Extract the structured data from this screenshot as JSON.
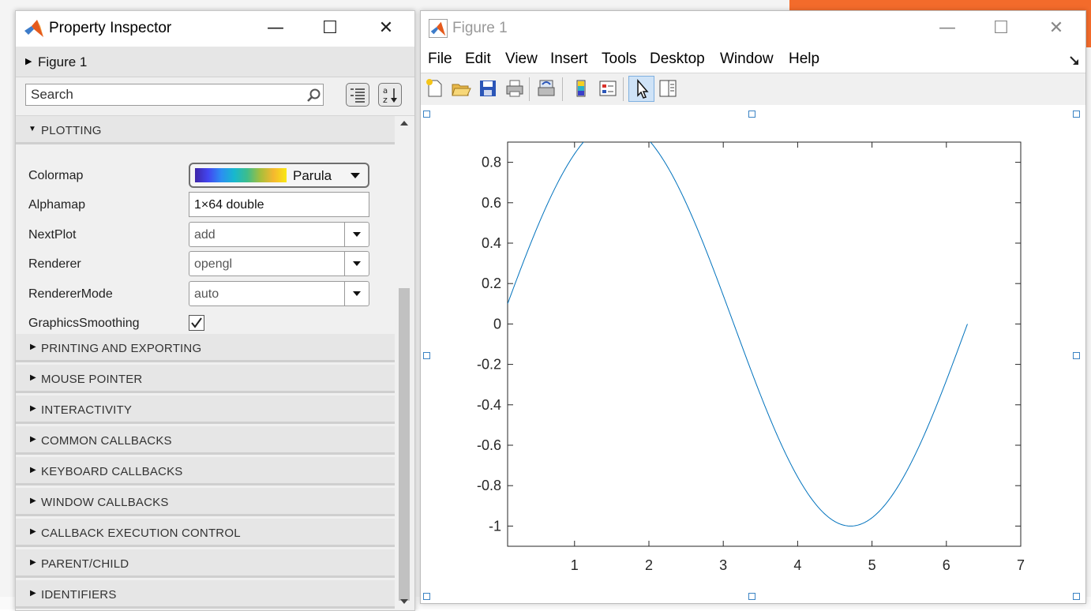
{
  "inspector": {
    "title": "Property Inspector",
    "object_label": "Figure 1",
    "search_placeholder": "Search",
    "plotting_section": "PLOTTING",
    "properties": {
      "colormap": {
        "label": "Colormap",
        "value": "Parula"
      },
      "alphamap": {
        "label": "Alphamap",
        "value": "1×64 double"
      },
      "nextplot": {
        "label": "NextPlot",
        "value": "add"
      },
      "renderer": {
        "label": "Renderer",
        "value": "opengl"
      },
      "renderermode": {
        "label": "RendererMode",
        "value": "auto"
      },
      "graphicssmoothing": {
        "label": "GraphicsSmoothing",
        "checked": true
      }
    },
    "sections": [
      "PRINTING AND EXPORTING",
      "MOUSE POINTER",
      "INTERACTIVITY",
      "COMMON CALLBACKS",
      "KEYBOARD CALLBACKS",
      "WINDOW CALLBACKS",
      "CALLBACK EXECUTION CONTROL",
      "PARENT/CHILD",
      "IDENTIFIERS"
    ]
  },
  "figure": {
    "title": "Figure 1",
    "menu": [
      "File",
      "Edit",
      "View",
      "Insert",
      "Tools",
      "Desktop",
      "Window",
      "Help"
    ],
    "toolbar_icons": [
      "new-figure-icon",
      "open-file-icon",
      "save-icon",
      "print-icon",
      "link-plot-icon",
      "insert-colorbar-icon",
      "insert-legend-icon",
      "edit-plot-icon",
      "property-editor-icon"
    ],
    "line_color": "#0072bd"
  },
  "chart_data": {
    "type": "line",
    "series": [
      {
        "function": "sin(x)",
        "x_start": 0.1,
        "x_end": 6.2832
      }
    ],
    "xlim": [
      0.1,
      7
    ],
    "ylim": [
      -1.1,
      0.9
    ],
    "xticks": [
      "1",
      "2",
      "3",
      "4",
      "5",
      "6",
      "7"
    ],
    "yticks": [
      "0.8",
      "0.6",
      "0.4",
      "0.2",
      "0",
      "-0.2",
      "-0.4",
      "-0.6",
      "-0.8",
      "-1"
    ],
    "xtick_values": [
      1,
      2,
      3,
      4,
      5,
      6,
      7
    ],
    "ytick_values": [
      0.8,
      0.6,
      0.4,
      0.2,
      0,
      -0.2,
      -0.4,
      -0.6,
      -0.8,
      -1
    ],
    "grid": false,
    "box": true
  }
}
